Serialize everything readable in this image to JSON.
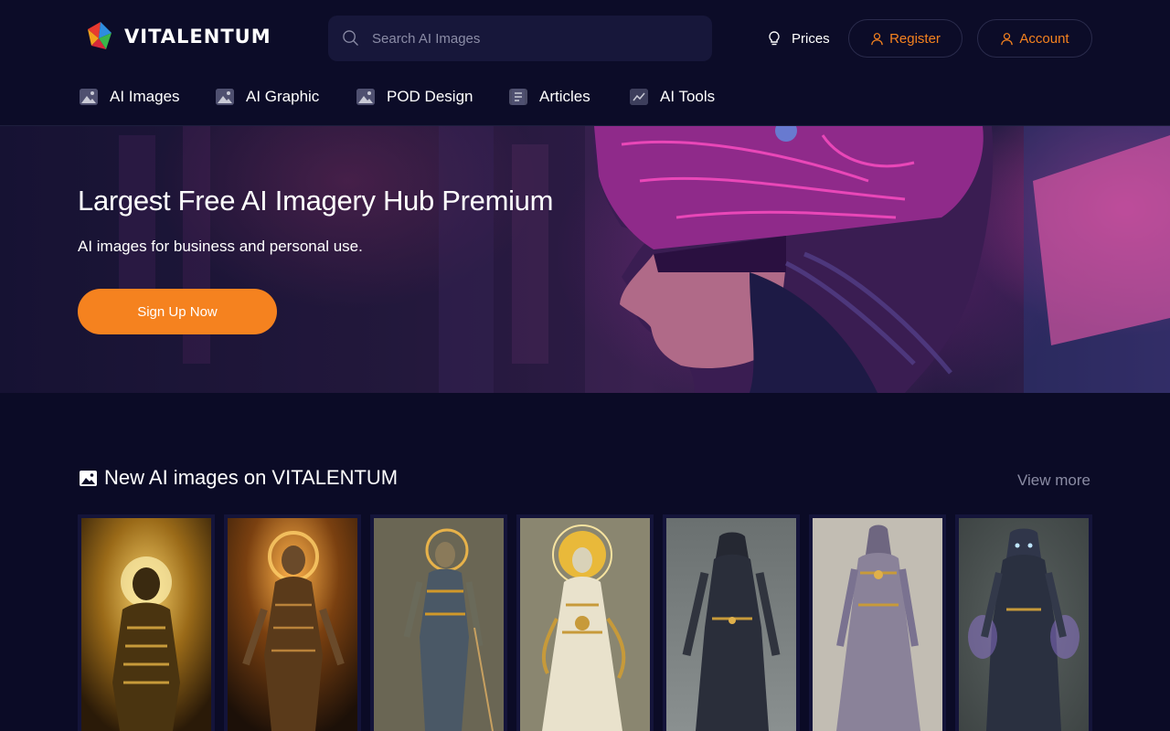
{
  "header": {
    "brand": "VITALENTUM",
    "search_placeholder": "Search AI Images",
    "prices_label": "Prices",
    "register_label": "Register",
    "account_label": "Account"
  },
  "category_nav": [
    {
      "label": "AI Images",
      "icon": "image-icon"
    },
    {
      "label": "AI Graphic",
      "icon": "image-icon"
    },
    {
      "label": "POD Design",
      "icon": "image-icon"
    },
    {
      "label": "Articles",
      "icon": "document-icon"
    },
    {
      "label": "AI Tools",
      "icon": "chart-icon"
    }
  ],
  "hero": {
    "title": "Largest Free AI Imagery Hub Premium",
    "subtitle": "AI images for business and personal use.",
    "cta_label": "Sign Up Now"
  },
  "new_images": {
    "title": "New AI images on VITALENTUM",
    "view_more_label": "View more",
    "cards": [
      {
        "style": "golden-mummy"
      },
      {
        "style": "glowing-mummy"
      },
      {
        "style": "bronze-warrior"
      },
      {
        "style": "gold-sun-deity"
      },
      {
        "style": "dark-shrouded-figure"
      },
      {
        "style": "violet-priestess"
      },
      {
        "style": "purple-aura-wraith"
      }
    ]
  },
  "colors": {
    "background": "#0b0b26",
    "accent": "#f5821f",
    "muted_text": "#8a8ba3",
    "search_bg": "#17173a"
  }
}
